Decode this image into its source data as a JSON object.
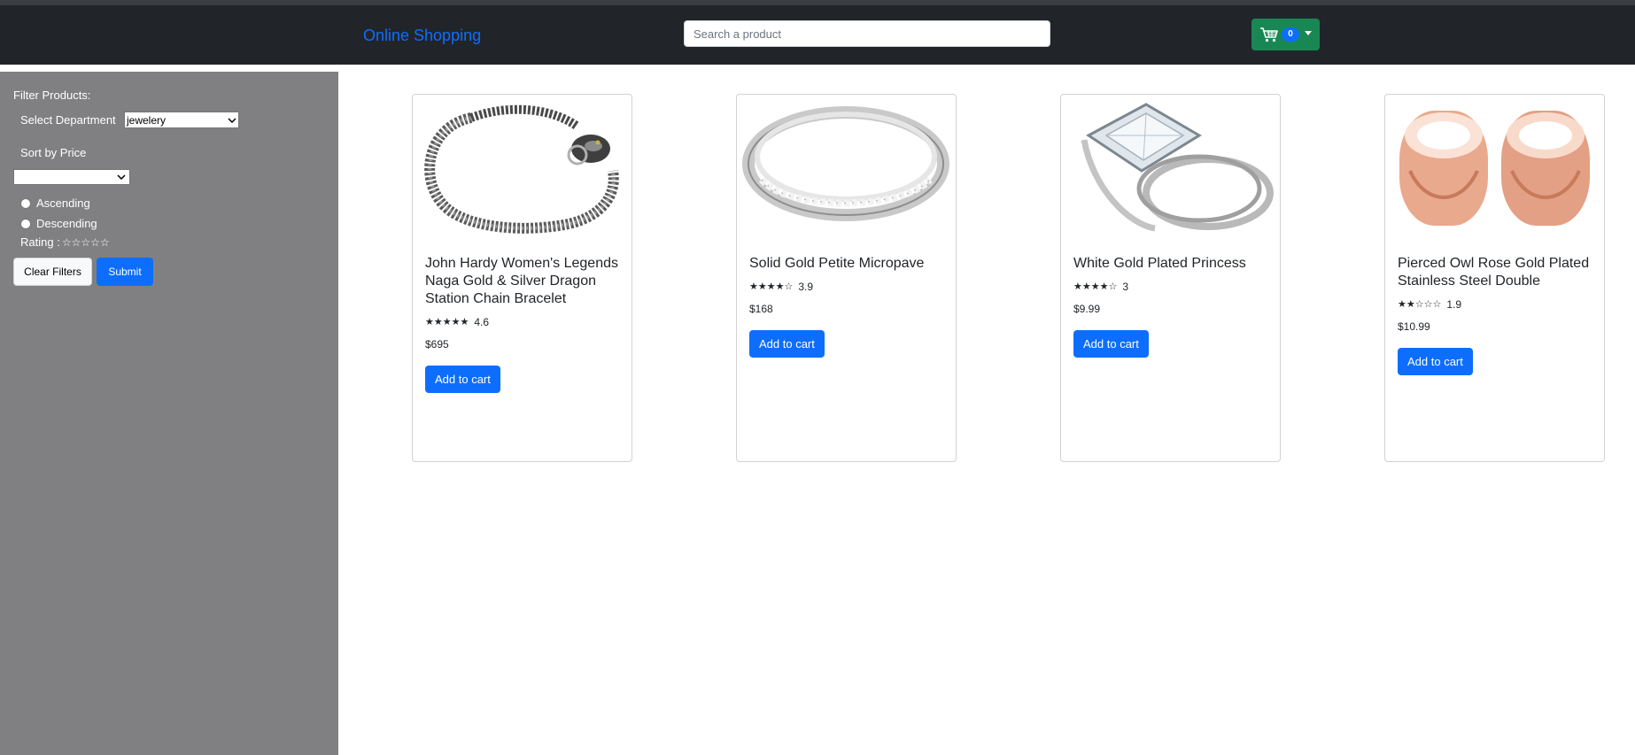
{
  "navbar": {
    "brand": "Online Shopping",
    "search_placeholder": "Search a product",
    "search_value": "",
    "cart_count": "0"
  },
  "sidebar": {
    "title": "Filter Products:",
    "department_label": "Select Department",
    "department_value": "jewelery",
    "sort_label": "Sort by Price",
    "sort_value": "",
    "ascending_label": "Ascending",
    "descending_label": "Descending",
    "rating_label": "Rating :",
    "rating_stars": "☆☆☆☆☆",
    "clear_label": "Clear Filters",
    "submit_label": "Submit"
  },
  "products": [
    {
      "title": "John Hardy Women's Legends Naga Gold & Silver Dragon Station Chain Bracelet",
      "stars": "★★★★★",
      "rating": "4.6",
      "price": "$695",
      "button": "Add to cart",
      "image_icon": "chain-bracelet"
    },
    {
      "title": "Solid Gold Petite Micropave",
      "stars": "★★★★☆",
      "rating": "3.9",
      "price": "$168",
      "button": "Add to cart",
      "image_icon": "silver-band-ring"
    },
    {
      "title": "White Gold Plated Princess",
      "stars": "★★★★☆",
      "rating": "3",
      "price": "$9.99",
      "button": "Add to cart",
      "image_icon": "diamond-ring"
    },
    {
      "title": "Pierced Owl Rose Gold Plated Stainless Steel Double",
      "stars": "★★☆☆☆",
      "rating": "1.9",
      "price": "$10.99",
      "button": "Add to cart",
      "image_icon": "rose-gold-tunnels"
    }
  ],
  "colors": {
    "navbar": "#212529",
    "sidebar": "#808083",
    "primary": "#0d6efd",
    "cart": "#198754"
  }
}
